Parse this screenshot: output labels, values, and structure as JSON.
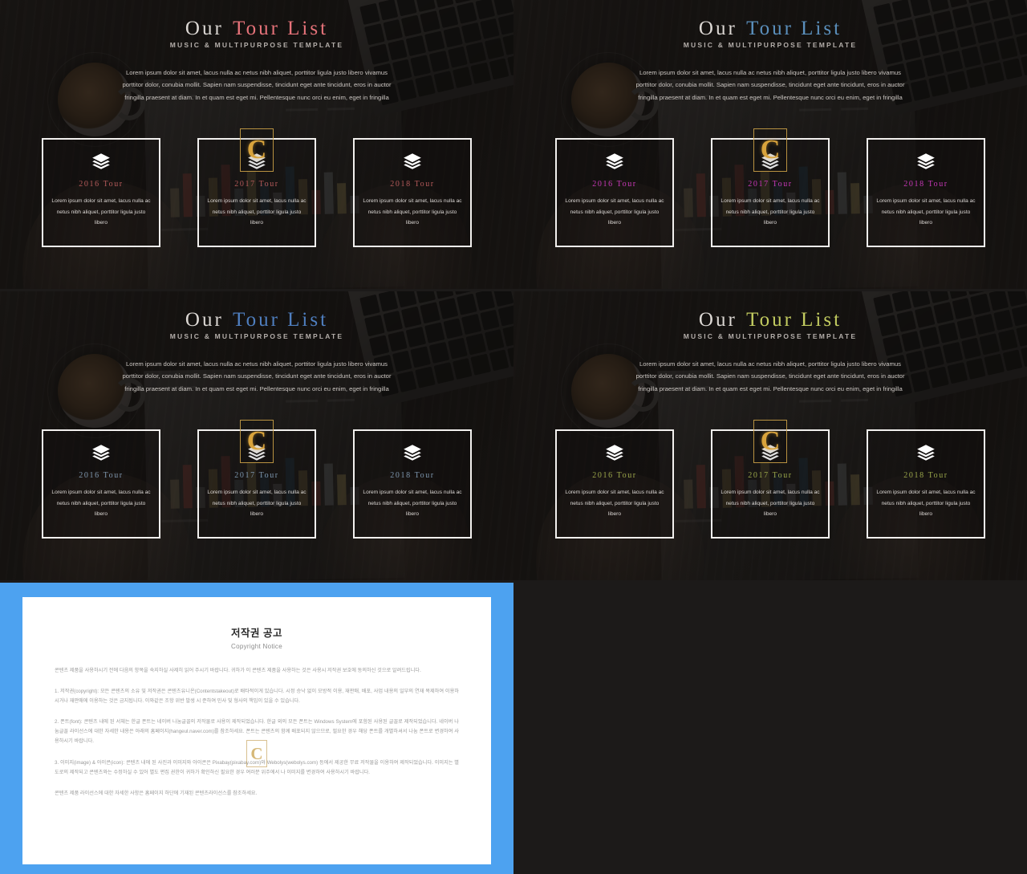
{
  "slides": [
    {
      "title_plain": "Our",
      "title_accent": "Tour List",
      "accent_color": "#e7737a",
      "subtitle": "MUSIC & MULTIPURPOSE TEMPLATE",
      "description": "Lorem ipsum dolor sit amet, lacus nulla ac netus nibh aliquet, porttitor ligula justo libero vivamus porttitor dolor, conubia mollit. Sapien nam suspendisse, tincidunt eget ante tincidunt, eros in auctor fringilla praesent at diam. In et quam est eget mi. Pellentesque nunc orci eu enim, eget in fringilla",
      "card_color": "#b55a5a",
      "cards": [
        {
          "year": "2016 Tour",
          "text": "Lorem ipsum dolor sit amet, lacus nulla ac netus nibh aliquet, porttitor ligula justo libero",
          "icon": "layers-icon"
        },
        {
          "year": "2017 Tour",
          "text": "Lorem ipsum dolor sit amet, lacus nulla ac netus nibh aliquet, porttitor ligula justo libero",
          "icon": "layers-icon"
        },
        {
          "year": "2018 Tour",
          "text": "Lorem ipsum dolor sit amet, lacus nulla ac netus nibh aliquet, porttitor ligula justo libero",
          "icon": "layers-icon"
        }
      ]
    },
    {
      "title_plain": "Our",
      "title_accent": "Tour List",
      "accent_color": "#5b90bd",
      "subtitle": "MUSIC & MULTIPURPOSE TEMPLATE",
      "description": "Lorem ipsum dolor sit amet, lacus nulla ac netus nibh aliquet, porttitor ligula justo libero vivamus porttitor dolor, conubia mollit. Sapien nam suspendisse, tincidunt eget ante tincidunt, eros in auctor fringilla praesent at diam. In et quam est eget mi. Pellentesque nunc orci eu enim, eget in fringilla",
      "card_color": "#c838b8",
      "cards": [
        {
          "year": "2016 Tour",
          "text": "Lorem ipsum dolor sit amet, lacus nulla ac netus nibh aliquet, porttitor ligula justo libero",
          "icon": "layers-icon"
        },
        {
          "year": "2017 Tour",
          "text": "Lorem ipsum dolor sit amet, lacus nulla ac netus nibh aliquet, porttitor ligula justo libero",
          "icon": "layers-icon"
        },
        {
          "year": "2018 Tour",
          "text": "Lorem ipsum dolor sit amet, lacus nulla ac netus nibh aliquet, porttitor ligula justo libero",
          "icon": "layers-icon"
        }
      ]
    },
    {
      "title_plain": "Our",
      "title_accent": "Tour List",
      "accent_color": "#4f7fc0",
      "subtitle": "MUSIC & MULTIPURPOSE TEMPLATE",
      "description": "Lorem ipsum dolor sit amet, lacus nulla ac netus nibh aliquet, porttitor ligula justo libero vivamus porttitor dolor, conubia mollit. Sapien nam suspendisse, tincidunt eget ante tincidunt, eros in auctor fringilla praesent at diam. In et quam est eget mi. Pellentesque nunc orci eu enim, eget in fringilla",
      "card_color": "#7d96ae",
      "cards": [
        {
          "year": "2016 Tour",
          "text": "Lorem ipsum dolor sit amet, lacus nulla ac netus nibh aliquet, porttitor ligula justo libero",
          "icon": "layers-icon"
        },
        {
          "year": "2017 Tour",
          "text": "Lorem ipsum dolor sit amet, lacus nulla ac netus nibh aliquet, porttitor ligula justo libero",
          "icon": "layers-icon"
        },
        {
          "year": "2018 Tour",
          "text": "Lorem ipsum dolor sit amet, lacus nulla ac netus nibh aliquet, porttitor ligula justo libero",
          "icon": "layers-icon"
        }
      ]
    },
    {
      "title_plain": "Our",
      "title_accent": "Tour List",
      "accent_color": "#c3cc60",
      "subtitle": "MUSIC & MULTIPURPOSE TEMPLATE",
      "description": "Lorem ipsum dolor sit amet, lacus nulla ac netus nibh aliquet, porttitor ligula justo libero vivamus porttitor dolor, conubia mollit. Sapien nam suspendisse, tincidunt eget ante tincidunt, eros in auctor fringilla praesent at diam. In et quam est eget mi. Pellentesque nunc orci eu enim, eget in fringilla",
      "card_color": "#9aa64a",
      "cards": [
        {
          "year": "2016 Tour",
          "text": "Lorem ipsum dolor sit amet, lacus nulla ac netus nibh aliquet, porttitor ligula justo libero",
          "icon": "layers-icon"
        },
        {
          "year": "2017 Tour",
          "text": "Lorem ipsum dolor sit amet, lacus nulla ac netus nibh aliquet, porttitor ligula justo libero",
          "icon": "layers-icon"
        },
        {
          "year": "2018 Tour",
          "text": "Lorem ipsum dolor sit amet, lacus nulla ac netus nibh aliquet, porttitor ligula justo libero",
          "icon": "layers-icon"
        }
      ]
    }
  ],
  "watermark": {
    "letter": "C",
    "color": "#d8a33c"
  },
  "document": {
    "title_ko": "저작권 공고",
    "title_en": "Copyright Notice",
    "intro": "콘텐츠 제품을 사용하시기 전에 다음의 항목을 숙지하실 사제히 읽어 주시기 바랍니다. 귀하가 이 콘텐츠 제품을 사용하는 것은 사용시 저작권 보호에 동의하신 것으로 알려드립니다.",
    "sections": [
      "1. 저작권(copyright): 모든 콘텐츠의 소유 및 저작권은 콘텐츠유니온(Contentstakeout)로 배타적이게 있습니다. 시정 승낙 없이 모방적 이용, 재판매, 배포, 사업 내용의 일부의 연재 복제하여 이용하시거나 재판매에 이용하는 것은 금지됩니다. 이와같은 조항 위반 발생 시 준하여 민사 및 형사의 책임이 있을 수 있습니다.",
      "2. 폰트(font): 콘텐츠 내에 된 서체는 한글 폰트는 네이버 나눔글꼴의 저작물로 사용이 제작되었습니다. 한글 외의 모든 폰트는 Windows System에 포함된 사용된 글꼴로 제작되었습니다. 네이버 나눔글꼴 라이선스에 대한 자세한 내용은 아래의 홈페이지(hangeul.naver.com)를 참조하세요. 폰트는 콘텐츠의 함께 배포되지 않으므로, 필요한 경우 해당 폰트를 개별하셔서 나눔 폰트로 변경하여 사용하시기 바랍니다.",
      "3. 이미지(image) & 아이콘(icon): 콘텐츠 내에 된 사진과 이미지와 아이콘은 Pixabay(pixabay.com)와 Webolys(webolys.com) 등에서 제공한 무료 저작물을 이용하여 제작되었습니다. 이미지는 별도로의 제작되고 콘텐츠와는 수정하실 수 있어 별도 편집 권한이 귀하가 확인하신 필요한 경우 여러분 위주에서 나 이미지를 변경하여 사용하시기 바랍니다."
    ],
    "footer": "콘텐츠 제품 라이선스에 대한 자세한 사항은 홈페이지 하단에 기재된 콘텐츠라이선스를 참조하세요."
  }
}
